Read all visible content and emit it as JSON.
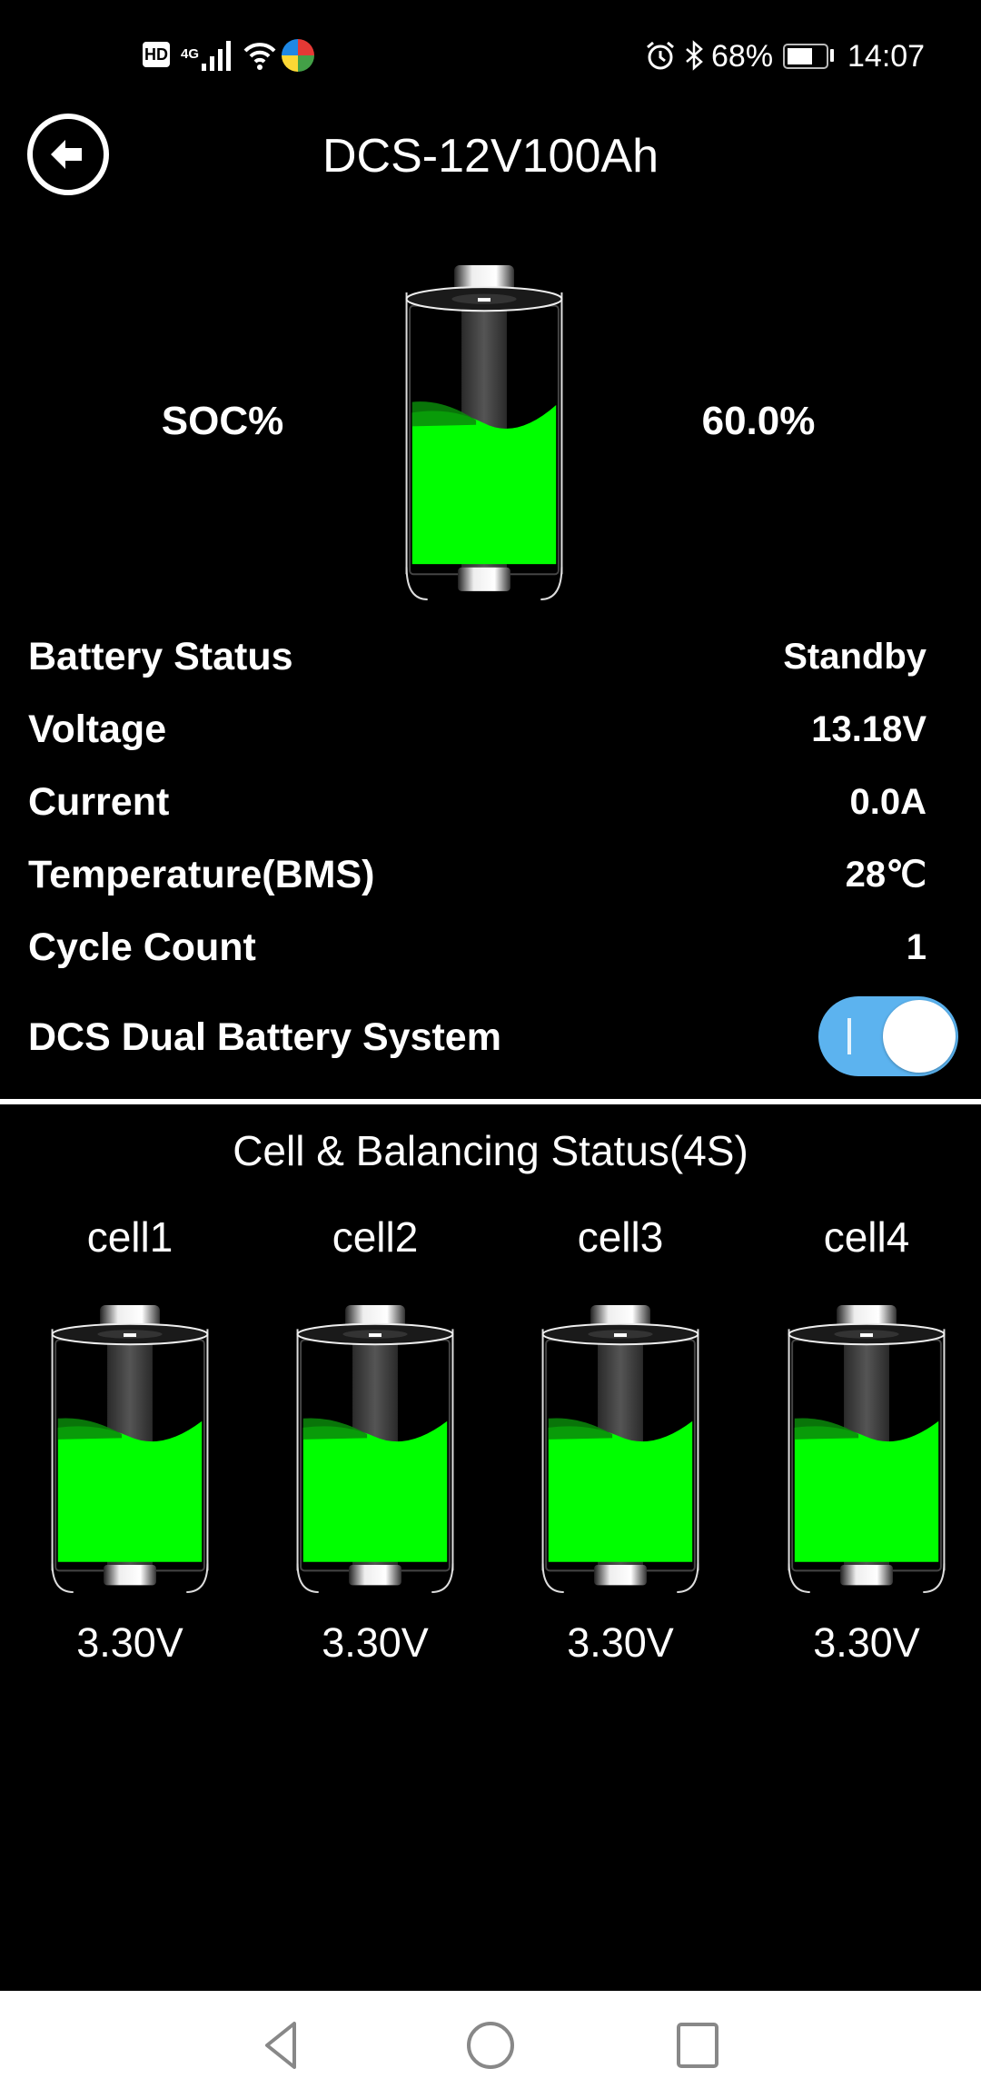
{
  "status_bar": {
    "left_icons": [
      "hd-icon",
      "signal-4g-icon",
      "wifi-icon",
      "app-notification-icon"
    ],
    "network_label": "4G",
    "hd_label": "HD",
    "right_icons": [
      "alarm-icon",
      "bluetooth-icon",
      "battery-icon"
    ],
    "battery_percent": "68%",
    "battery_level": 0.68,
    "time": "14:07"
  },
  "header": {
    "back_icon": "arrow-left-circle-icon",
    "title": "DCS-12V100Ah"
  },
  "soc": {
    "label": "SOC%",
    "value": "60.0%",
    "level": 0.6,
    "fill_color": "#00ff00"
  },
  "info_rows": [
    {
      "label": "Battery Status",
      "value": "Standby"
    },
    {
      "label": "Voltage",
      "value": "13.18V"
    },
    {
      "label": "Current",
      "value": "0.0A"
    },
    {
      "label": "Temperature(BMS)",
      "value": "28℃"
    },
    {
      "label": "Cycle Count",
      "value": "1"
    }
  ],
  "dual_battery": {
    "label": "DCS Dual Battery System",
    "enabled": true,
    "accent_color": "#5cb3ef"
  },
  "cells_section": {
    "title": "Cell & Balancing Status(4S)",
    "cells": [
      {
        "name": "cell1",
        "voltage": "3.30V"
      },
      {
        "name": "cell2",
        "voltage": "3.30V"
      },
      {
        "name": "cell3",
        "voltage": "3.30V"
      },
      {
        "name": "cell4",
        "voltage": "3.30V"
      }
    ]
  },
  "nav_bar": {
    "buttons": [
      "back-triangle-icon",
      "home-circle-icon",
      "recents-square-icon"
    ]
  }
}
